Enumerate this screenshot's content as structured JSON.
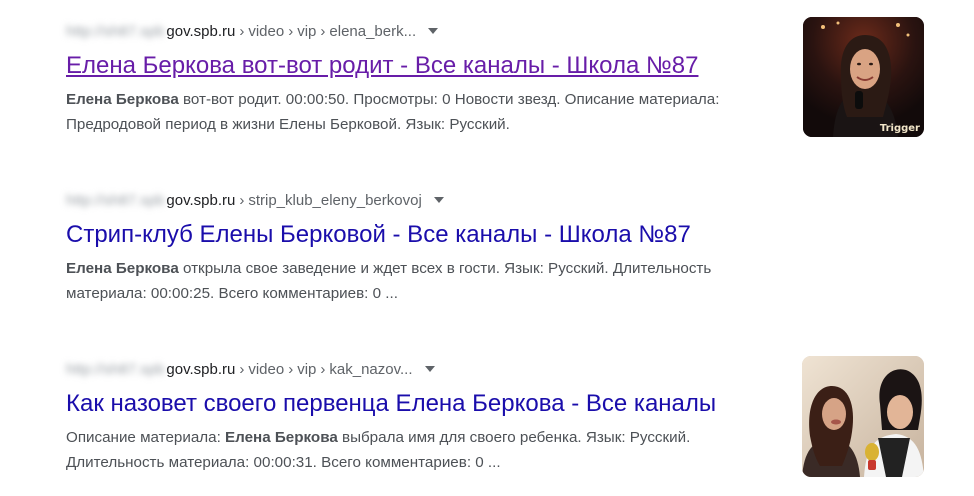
{
  "results": [
    {
      "url_blurred": "http://sh87.spb",
      "host": "gov.spb.ru",
      "crumbs": [
        "video",
        "vip",
        "elena_berk..."
      ],
      "title": "Елена Беркова вот-вот родит - Все каналы - Школа №87",
      "snippet": {
        "bold": "Елена Беркова",
        "text": " вот-вот родит. 00:00:50. Просмотры: 0 Новости звезд. Описание материала: Предродовой период в жизни Елены Берковой. Язык: Русский.",
        "prefix": ""
      },
      "thumbnail": "woman-portrait-thumbnail",
      "thumb_watermark": "Trigger"
    },
    {
      "url_blurred": "http://sh87.spb",
      "host": "gov.spb.ru",
      "crumbs": [
        "strip_klub_eleny_berkovoj"
      ],
      "title": "Стрип-клуб Елены Берковой - Все каналы - Школа №87",
      "snippet": {
        "prefix": "",
        "bold": "Елена Беркова",
        "text": " открыла свое заведение и ждет всех в гости. Язык: Русский. Длительность материала: 00:00:25. Всего комментариев: 0 ..."
      }
    },
    {
      "url_blurred": "http://sh87.spb",
      "host": "gov.spb.ru",
      "crumbs": [
        "video",
        "vip",
        "kak_nazov..."
      ],
      "title": "Как назовет своего первенца Елена Беркова - Все каналы",
      "snippet": {
        "prefix": "Описание материала: ",
        "bold": "Елена Беркова",
        "text": " выбрала имя для своего ребенка. Язык: Русский. Длительность материала: 00:00:31. Всего комментариев: 0 ..."
      },
      "thumbnail": "interview-thumbnail"
    }
  ],
  "colors": {
    "link": "#1a0dab",
    "visited": "#681da8",
    "snippet": "#4d5156"
  }
}
